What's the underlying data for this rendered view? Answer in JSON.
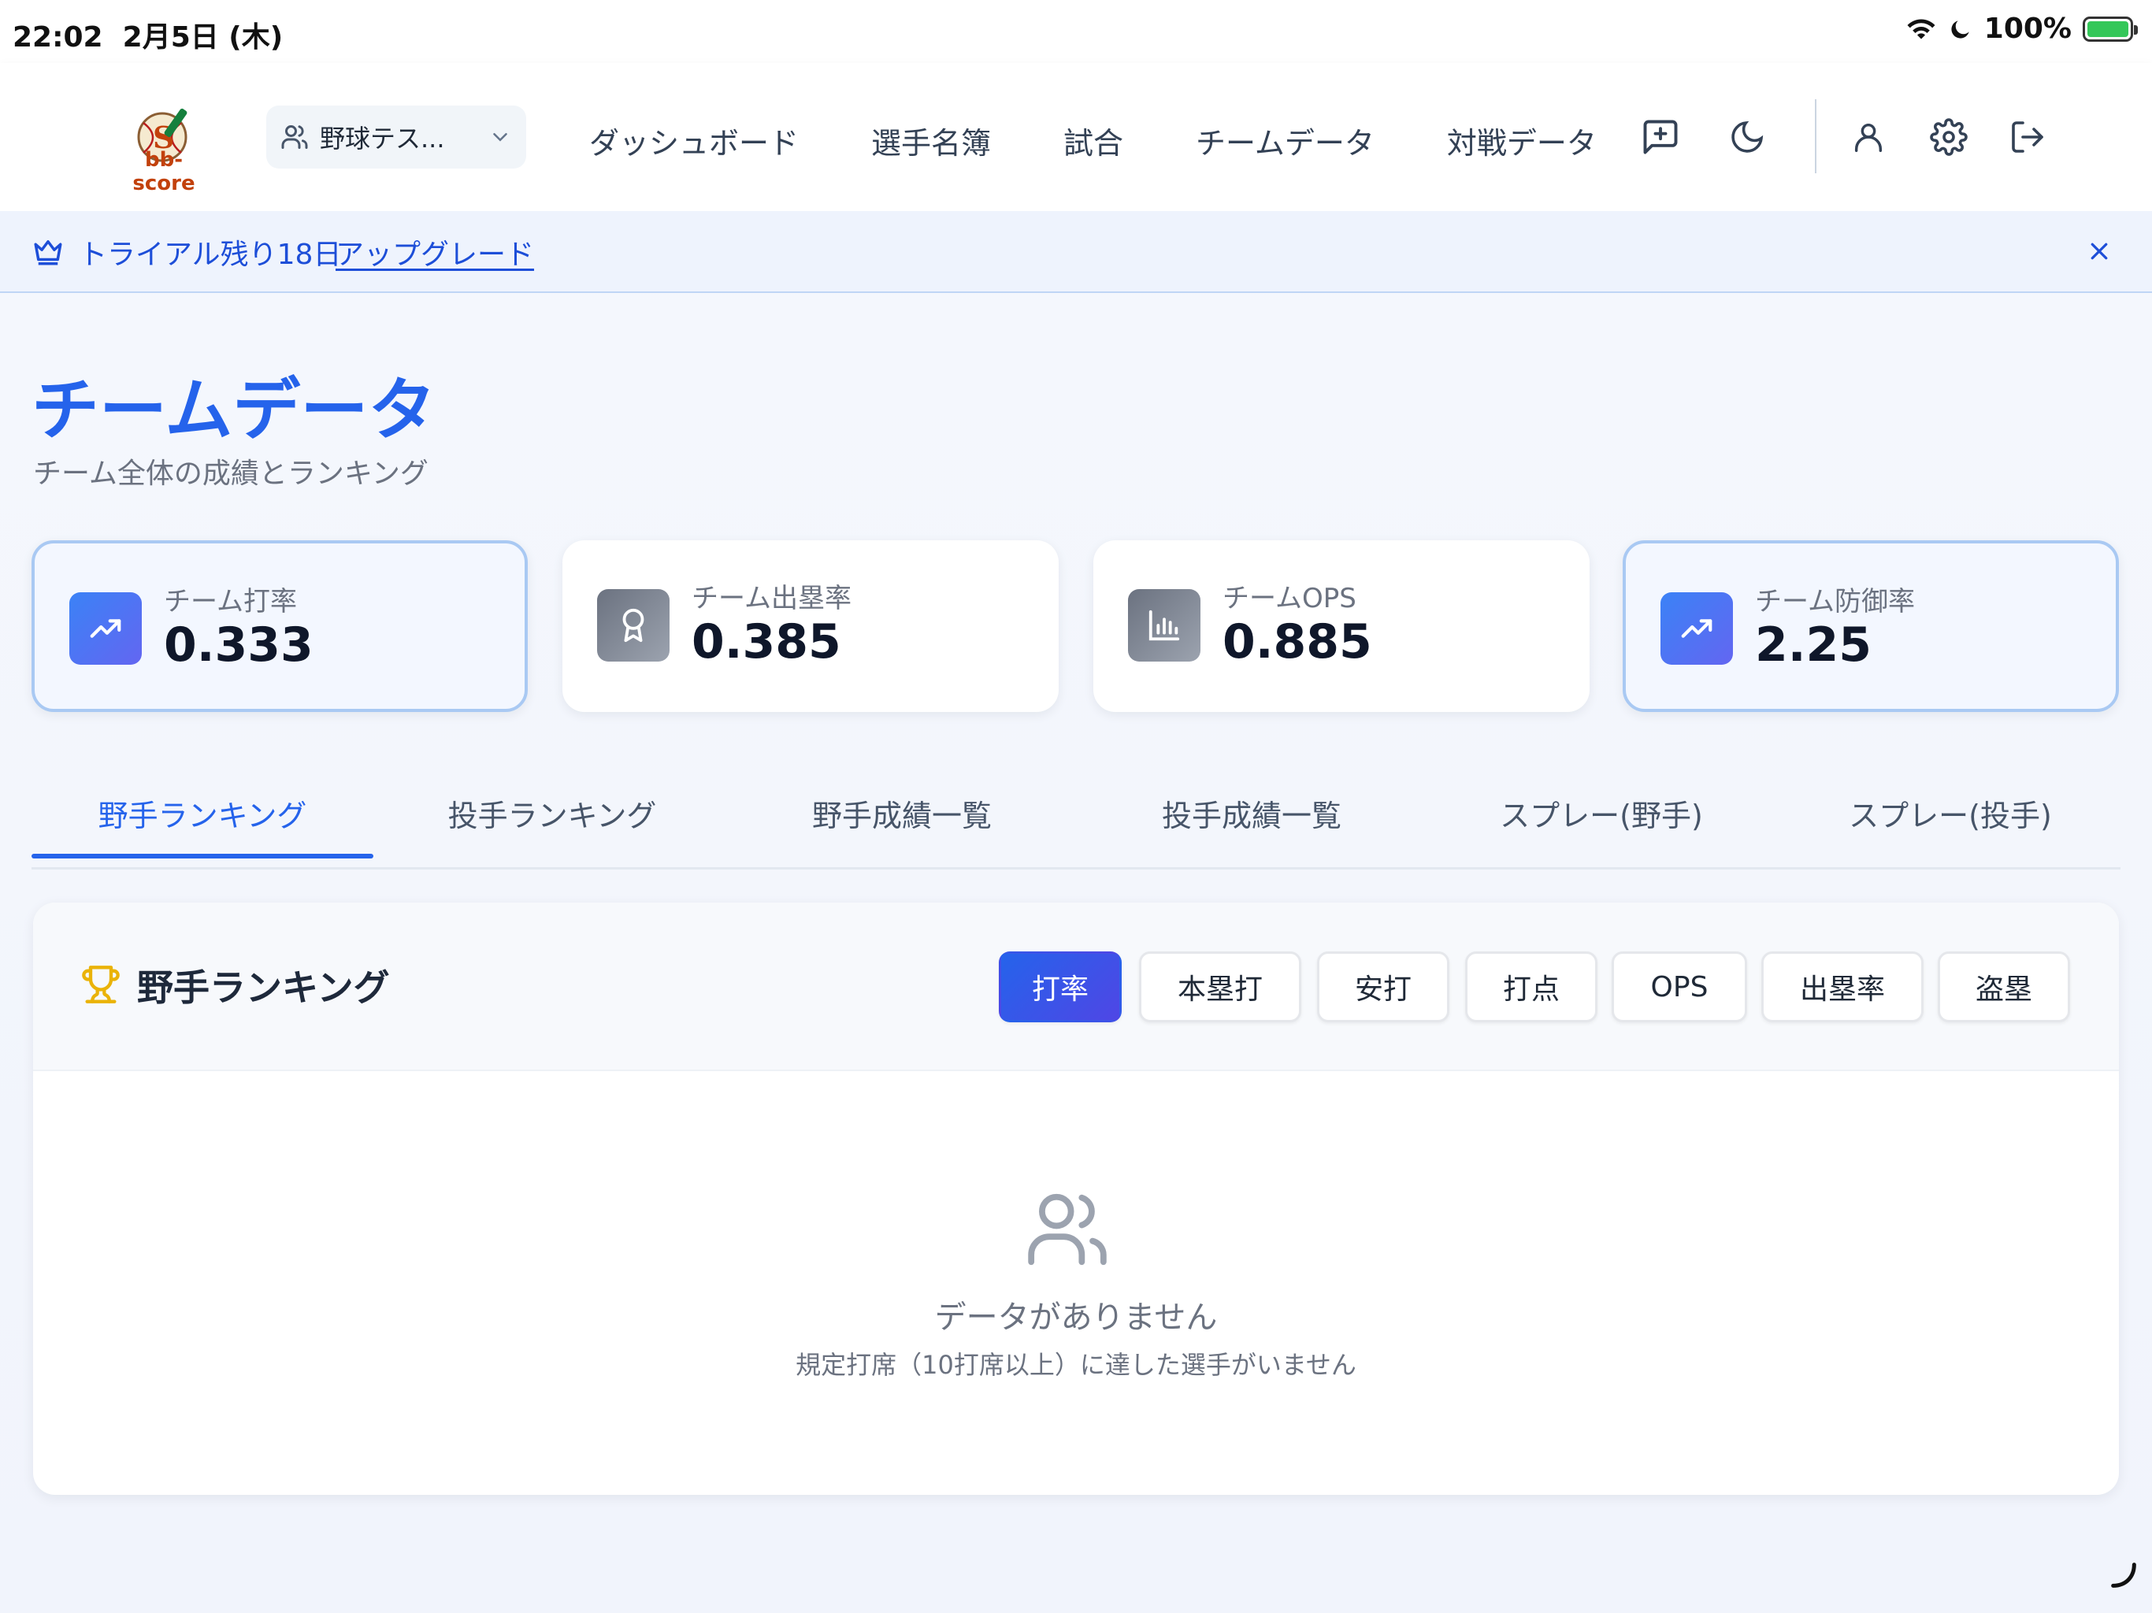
{
  "status_bar": {
    "time": "22:02",
    "date": "2月5日 (木)",
    "battery": "100%"
  },
  "header": {
    "logo_text": "bb-score",
    "team_select": "野球テス...",
    "nav": [
      "ダッシュボード",
      "選手名簿",
      "試合",
      "チームデータ",
      "対戦データ"
    ]
  },
  "trial": {
    "text": "トライアル残り18日",
    "link": "アップグレード"
  },
  "page": {
    "title": "チームデータ",
    "subtitle": "チーム全体の成績とランキング"
  },
  "stats": [
    {
      "label": "チーム打率",
      "value": "0.333",
      "icon": "trending-up-icon"
    },
    {
      "label": "チーム出塁率",
      "value": "0.385",
      "icon": "award-icon"
    },
    {
      "label": "チームOPS",
      "value": "0.885",
      "icon": "bar-chart-icon"
    },
    {
      "label": "チーム防御率",
      "value": "2.25",
      "icon": "trending-up-icon"
    }
  ],
  "tabs": [
    "野手ランキング",
    "投手ランキング",
    "野手成績一覧",
    "投手成績一覧",
    "スプレー(野手)",
    "スプレー(投手)"
  ],
  "ranking": {
    "title": "野手ランキング",
    "filters": [
      "打率",
      "本塁打",
      "安打",
      "打点",
      "OPS",
      "出塁率",
      "盗塁"
    ],
    "empty_title": "データがありません",
    "empty_sub": "規定打席（10打席以上）に達した選手がいません"
  },
  "colors": {
    "accent": "#2563eb",
    "active_pill_start": "#2563eb",
    "active_pill_end": "#4f46e5",
    "battery": "#34c759",
    "logo": "#c2410c"
  }
}
